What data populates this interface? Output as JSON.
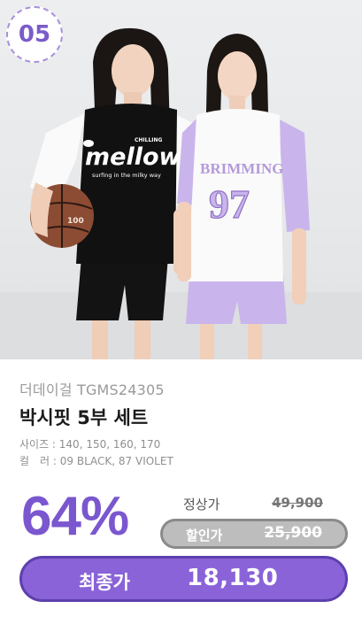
{
  "badge": {
    "number": "05"
  },
  "photo": {
    "left_shirt_text": "mellow",
    "left_shirt_tagline": "surfing in the milky way",
    "left_shirt_small_text": "CHILLING",
    "right_shirt_text": "BRIMMING",
    "right_shirt_number": "97",
    "basketball_text": "100"
  },
  "product": {
    "brand": "더데이걸 TGMS24305",
    "name": "박시핏 5부 세트",
    "size_line": "사이즈 : 140, 150, 160, 170",
    "color_line": "컬　러 : 09 BLACK, 87 VIOLET"
  },
  "pricing": {
    "discount_rate": "64%",
    "regular_label": "정상가",
    "regular_price": "49,900",
    "sale_label": "할인가",
    "sale_price": "25,900",
    "final_label": "최종가",
    "final_price": "18,130"
  },
  "colors": {
    "accent": "#7a57cf",
    "final_pill": "#8a63d8",
    "sale_pill": "#bdbdbd",
    "lavender": "#c9b5ec",
    "black_shirt": "#111111"
  }
}
